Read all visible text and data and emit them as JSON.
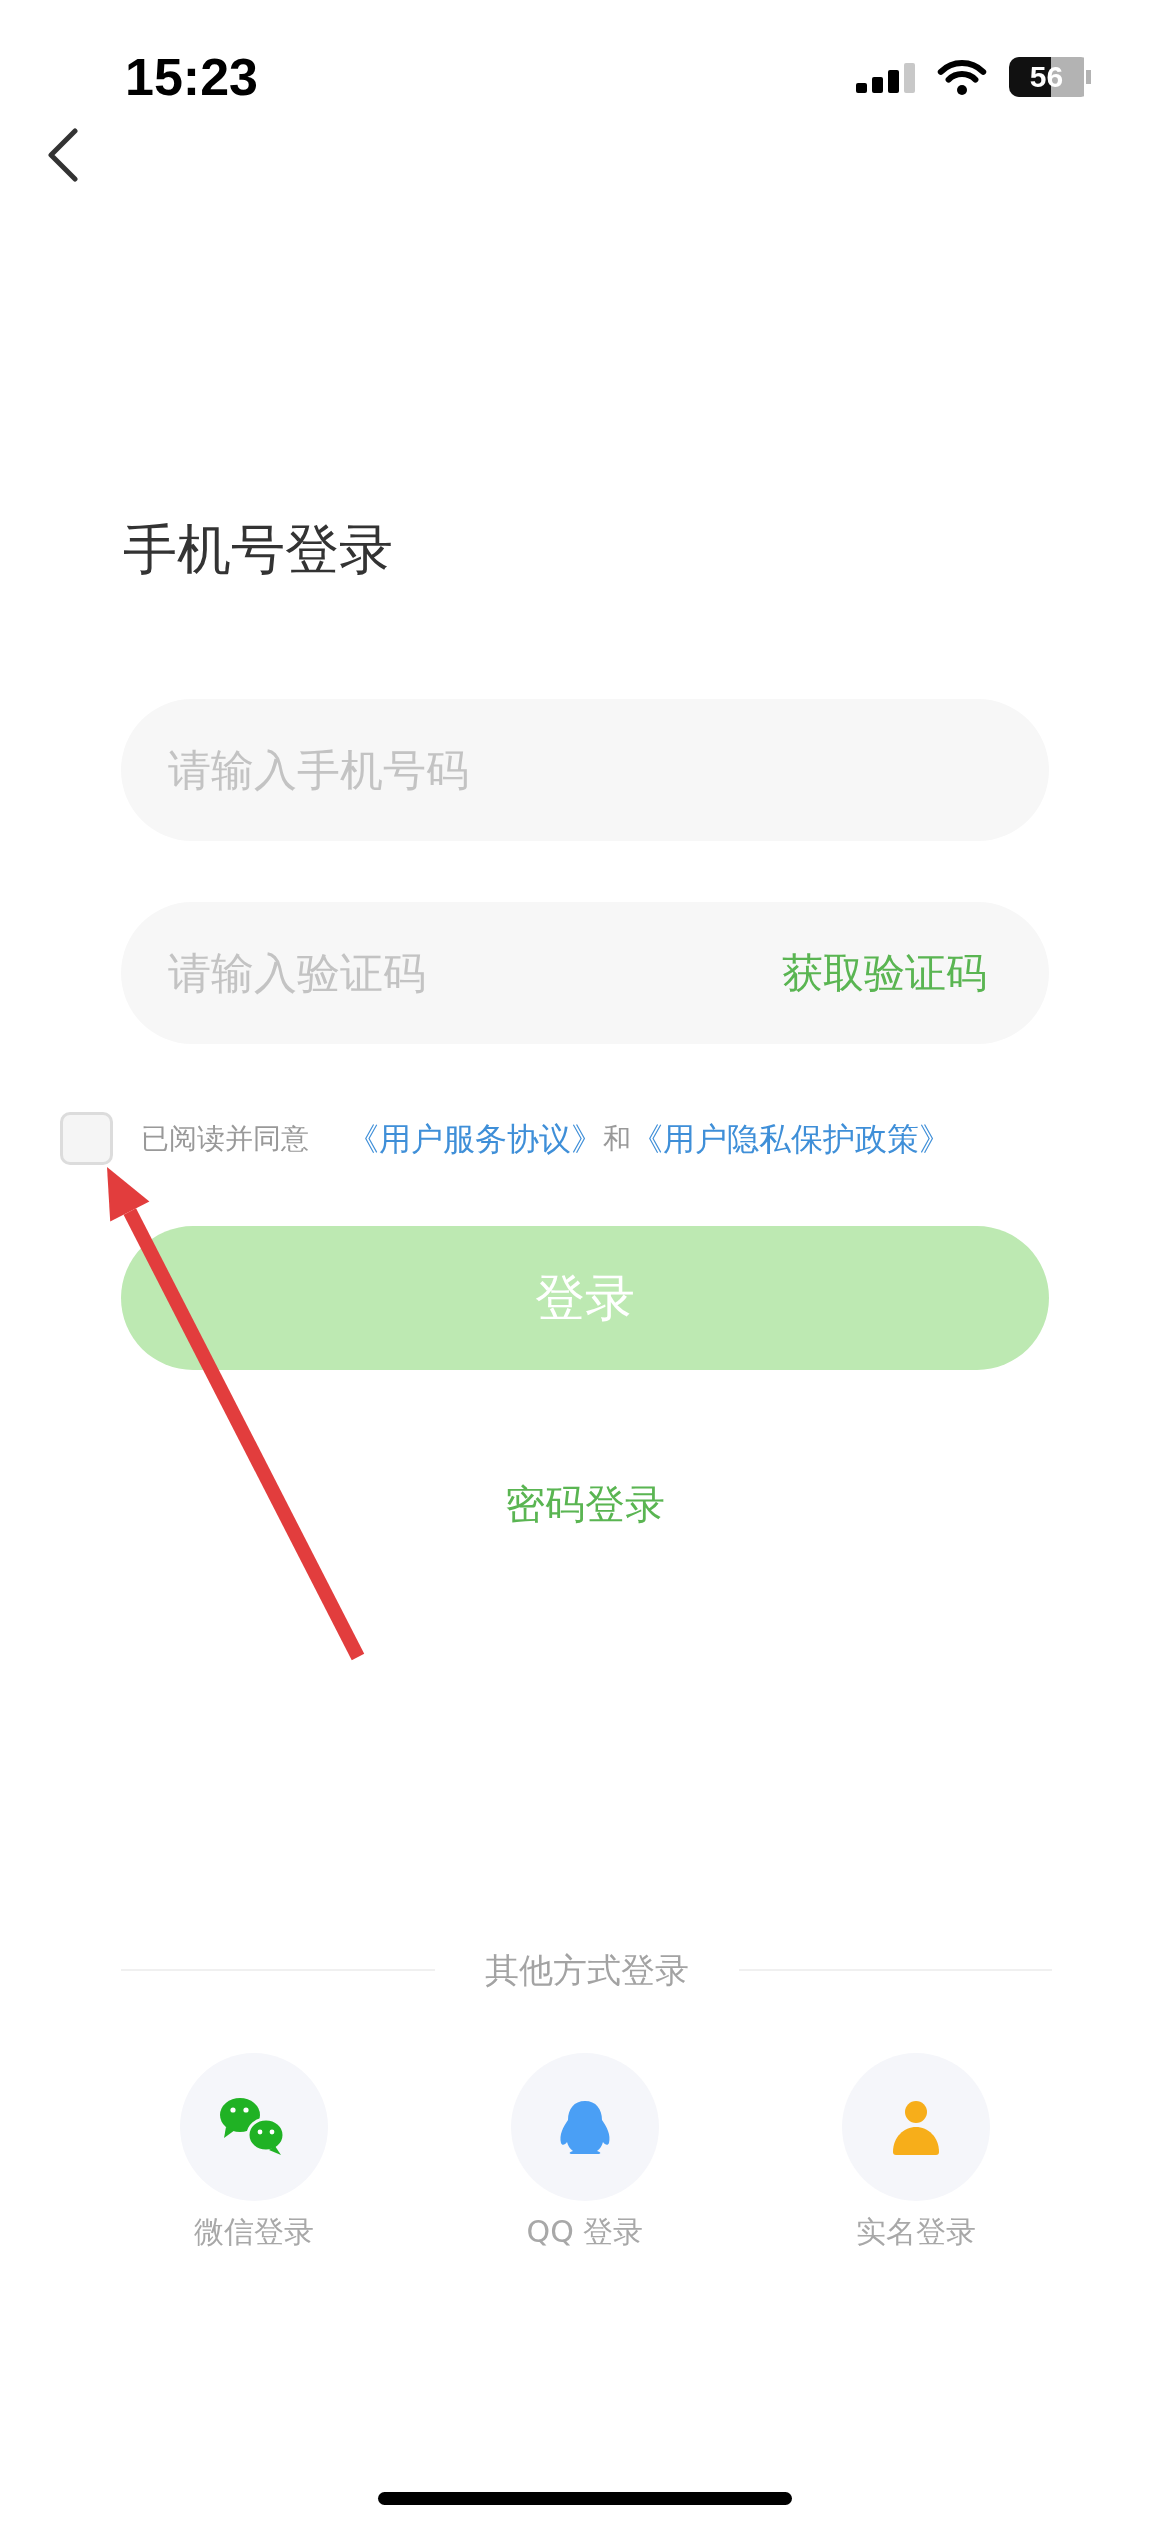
{
  "status_bar": {
    "time": "15:23",
    "battery": "56"
  },
  "title": "手机号登录",
  "phone_field": {
    "placeholder": "请输入手机号码"
  },
  "code_field": {
    "placeholder": "请输入验证码",
    "action": "获取验证码"
  },
  "agreement": {
    "checked": false,
    "parts": [
      {
        "kind": "text",
        "text": "已阅读并同意"
      },
      {
        "kind": "link",
        "text": "《用户服务协议》"
      },
      {
        "kind": "text",
        "text": "和"
      },
      {
        "kind": "link",
        "text": "《用户隐私保护政策》"
      }
    ]
  },
  "login_button": {
    "label": "登录",
    "disabled": true
  },
  "password_login": "密码登录",
  "other_login": {
    "title": "其他方式登录",
    "methods": [
      {
        "kind": "wechat",
        "label": "微信登录"
      },
      {
        "kind": "qq",
        "label": "QQ 登录"
      },
      {
        "kind": "person",
        "label": "实名登录"
      }
    ]
  },
  "annotations": [
    {
      "kind": "arrow"
    }
  ]
}
